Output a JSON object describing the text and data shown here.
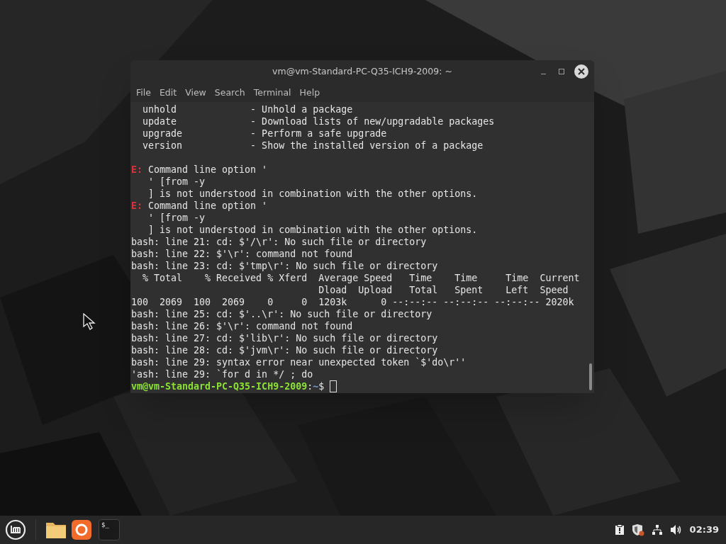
{
  "window": {
    "title": "vm@vm-Standard-PC-Q35-ICH9-2009: ~"
  },
  "menu": [
    "File",
    "Edit",
    "View",
    "Search",
    "Terminal",
    "Help"
  ],
  "lines": [
    {
      "kind": "plain",
      "text": "  unhold             - Unhold a package"
    },
    {
      "kind": "plain",
      "text": "  update             - Download lists of new/upgradable packages"
    },
    {
      "kind": "plain",
      "text": "  upgrade            - Perform a safe upgrade"
    },
    {
      "kind": "plain",
      "text": "  version            - Show the installed version of a package"
    },
    {
      "kind": "blank"
    },
    {
      "kind": "error",
      "prefix": "E:",
      "text": "Command line option '"
    },
    {
      "kind": "plain",
      "text": "   ' [from -y"
    },
    {
      "kind": "plain",
      "text": "   ] is not understood in combination with the other options."
    },
    {
      "kind": "error",
      "prefix": "E:",
      "text": "Command line option '"
    },
    {
      "kind": "plain",
      "text": "   ' [from -y"
    },
    {
      "kind": "plain",
      "text": "   ] is not understood in combination with the other options."
    },
    {
      "kind": "plain",
      "text": "bash: line 21: cd: $'/\\r': No such file or directory"
    },
    {
      "kind": "plain",
      "text": "bash: line 22: $'\\r': command not found"
    },
    {
      "kind": "plain",
      "text": "bash: line 23: cd: $'tmp\\r': No such file or directory"
    },
    {
      "kind": "plain",
      "text": "  % Total    % Received % Xferd  Average Speed   Time    Time     Time  Current"
    },
    {
      "kind": "plain",
      "text": "                                 Dload  Upload   Total   Spent    Left  Speed"
    },
    {
      "kind": "plain",
      "text": "100  2069  100  2069    0     0  1203k      0 --:--:-- --:--:-- --:--:-- 2020k"
    },
    {
      "kind": "plain",
      "text": "bash: line 25: cd: $'..\\r': No such file or directory"
    },
    {
      "kind": "plain",
      "text": "bash: line 26: $'\\r': command not found"
    },
    {
      "kind": "plain",
      "text": "bash: line 27: cd: $'lib\\r': No such file or directory"
    },
    {
      "kind": "plain",
      "text": "bash: line 28: cd: $'jvm\\r': No such file or directory"
    },
    {
      "kind": "plain",
      "text": "bash: line 29: syntax error near unexpected token `$'do\\r''"
    },
    {
      "kind": "plain",
      "text": "'ash: line 29: `for d in */ ; do"
    },
    {
      "kind": "prompt",
      "user": "vm@vm-Standard-PC-Q35-ICH9-2009",
      "sep": ":",
      "path": "~",
      "sign": "$"
    }
  ],
  "taskbar": {
    "terminal_label": "$_",
    "clock": "02:39"
  }
}
